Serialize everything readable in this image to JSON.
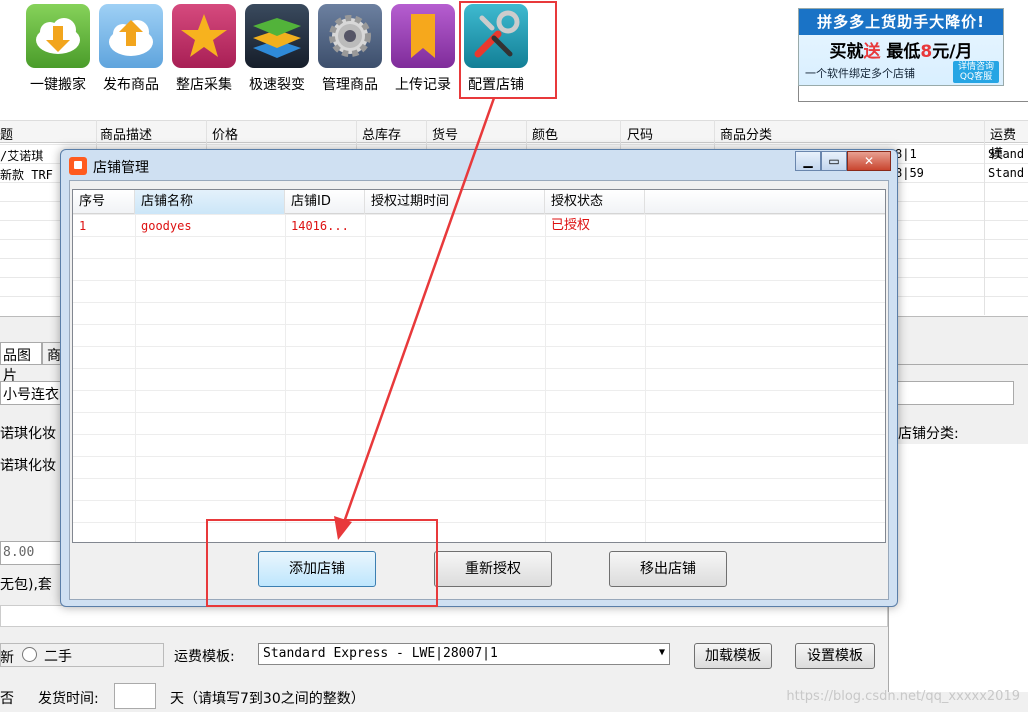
{
  "toolbar": {
    "items": [
      {
        "label": "一键搬家",
        "icon": "download-cloud-icon",
        "color": "#5fb336"
      },
      {
        "label": "发布商品",
        "icon": "upload-cloud-icon",
        "color": "#2f86d8"
      },
      {
        "label": "整店采集",
        "icon": "star-icon",
        "color": "#c0306a"
      },
      {
        "label": "极速裂变",
        "icon": "layers-icon",
        "color": "#1f2a3a"
      },
      {
        "label": "管理商品",
        "icon": "gear-icon",
        "color": "#4b5f7e"
      },
      {
        "label": "上传记录",
        "icon": "bookmark-icon",
        "color": "#9b3fb5"
      },
      {
        "label": "配置店铺",
        "icon": "tools-icon",
        "color": "#1f9ab0"
      }
    ]
  },
  "ad": {
    "line1": "拼多多上货助手大降价!",
    "line2_a": "买就",
    "line2_b": "送",
    "line2_c": " 最低",
    "line2_d": "8",
    "line2_e": "元/月",
    "line3": "一个软件绑定多个店铺",
    "qq": "详情咨询 QQ客服"
  },
  "grid": {
    "headers": [
      "题",
      "商品描述",
      "价格",
      "总库存",
      "货号",
      "颜色",
      "尺码",
      "商品分类",
      "运费模"
    ],
    "rows": [
      {
        "title": "/艾诺琪",
        "tail1": "8|1",
        "tail2": "Stand"
      },
      {
        "title": "新款 TRF",
        "tail1": "8|59",
        "tail2": "Stand"
      }
    ]
  },
  "lower": {
    "tabs": [
      "品图片",
      "商"
    ],
    "line_a": "小号连衣",
    "line_b": "诺琪化妆",
    "line_c": "诺琪化妆",
    "price": "8.00",
    "postage": "无包),套",
    "shop_category_label": "店铺分类:",
    "condition_new": "新",
    "condition_used": "二手",
    "freight_label": "运费模板:",
    "freight_value": "Standard Express - LWE|28007|1",
    "load_template": "加载模板",
    "set_template": "设置模板",
    "no_label": "否",
    "ship_time_label": "发货时间:",
    "ship_time_hint": "天（请填写7到30之间的整数）"
  },
  "dialog": {
    "title": "店铺管理",
    "columns": [
      "序号",
      "店铺名称",
      "店铺ID",
      "授权过期时间",
      "授权状态"
    ],
    "rows": [
      {
        "index": "1",
        "name": "goodyes",
        "id": "14016...",
        "expires": "",
        "status": "已授权"
      }
    ],
    "buttons": {
      "add": "添加店铺",
      "reauth": "重新授权",
      "remove": "移出店铺"
    }
  },
  "watermark": "https://blog.csdn.net/qq_xxxxx2019",
  "colors": {
    "annotation": "#e8393b",
    "row_text": "#d11111"
  }
}
